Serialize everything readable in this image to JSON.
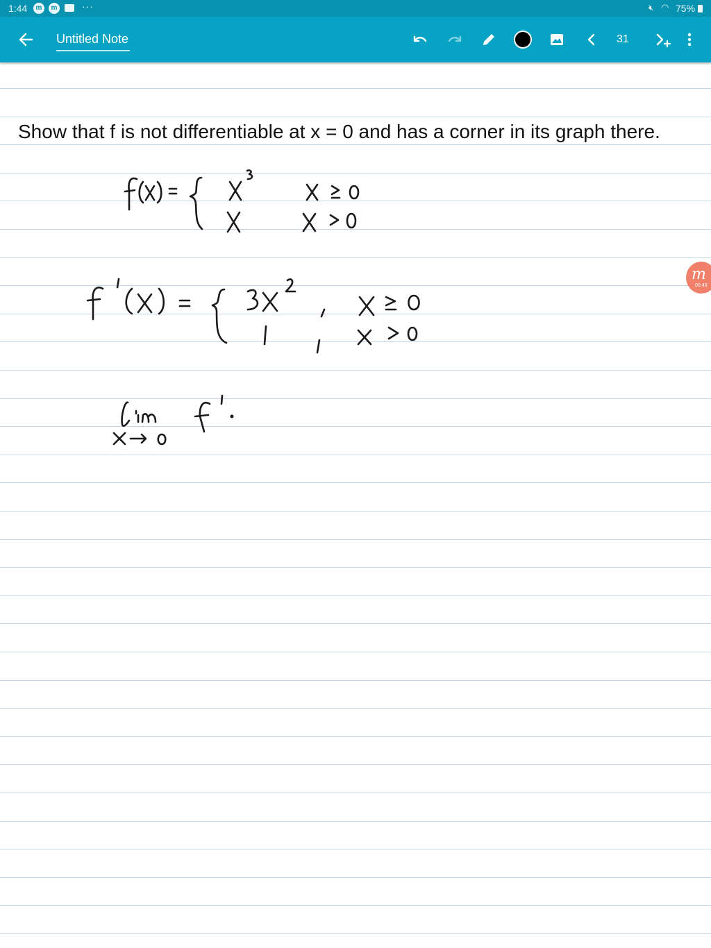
{
  "status_bar": {
    "time": "1:44",
    "notification_glyph": "m",
    "more": "···",
    "battery_text": "75%",
    "icons": [
      "mute-icon",
      "wifi-icon",
      "battery-icon",
      "gallery-icon"
    ]
  },
  "toolbar": {
    "title": "Untitled Note",
    "page_number": "31",
    "pen_color": "#000000",
    "icons": [
      "back-arrow-icon",
      "undo-icon",
      "redo-icon",
      "pen-icon",
      "color-dot-icon",
      "image-icon",
      "chevron-left-icon",
      "next-page-add-icon",
      "overflow-menu-icon"
    ],
    "colors": {
      "bar": "#07a3c4",
      "status": "#0792b0"
    }
  },
  "note": {
    "prompt": "Show that f is not differentiable at x = 0 and has a corner in its graph there."
  },
  "recording_badge": {
    "glyph": "m",
    "timer": "00:43"
  }
}
